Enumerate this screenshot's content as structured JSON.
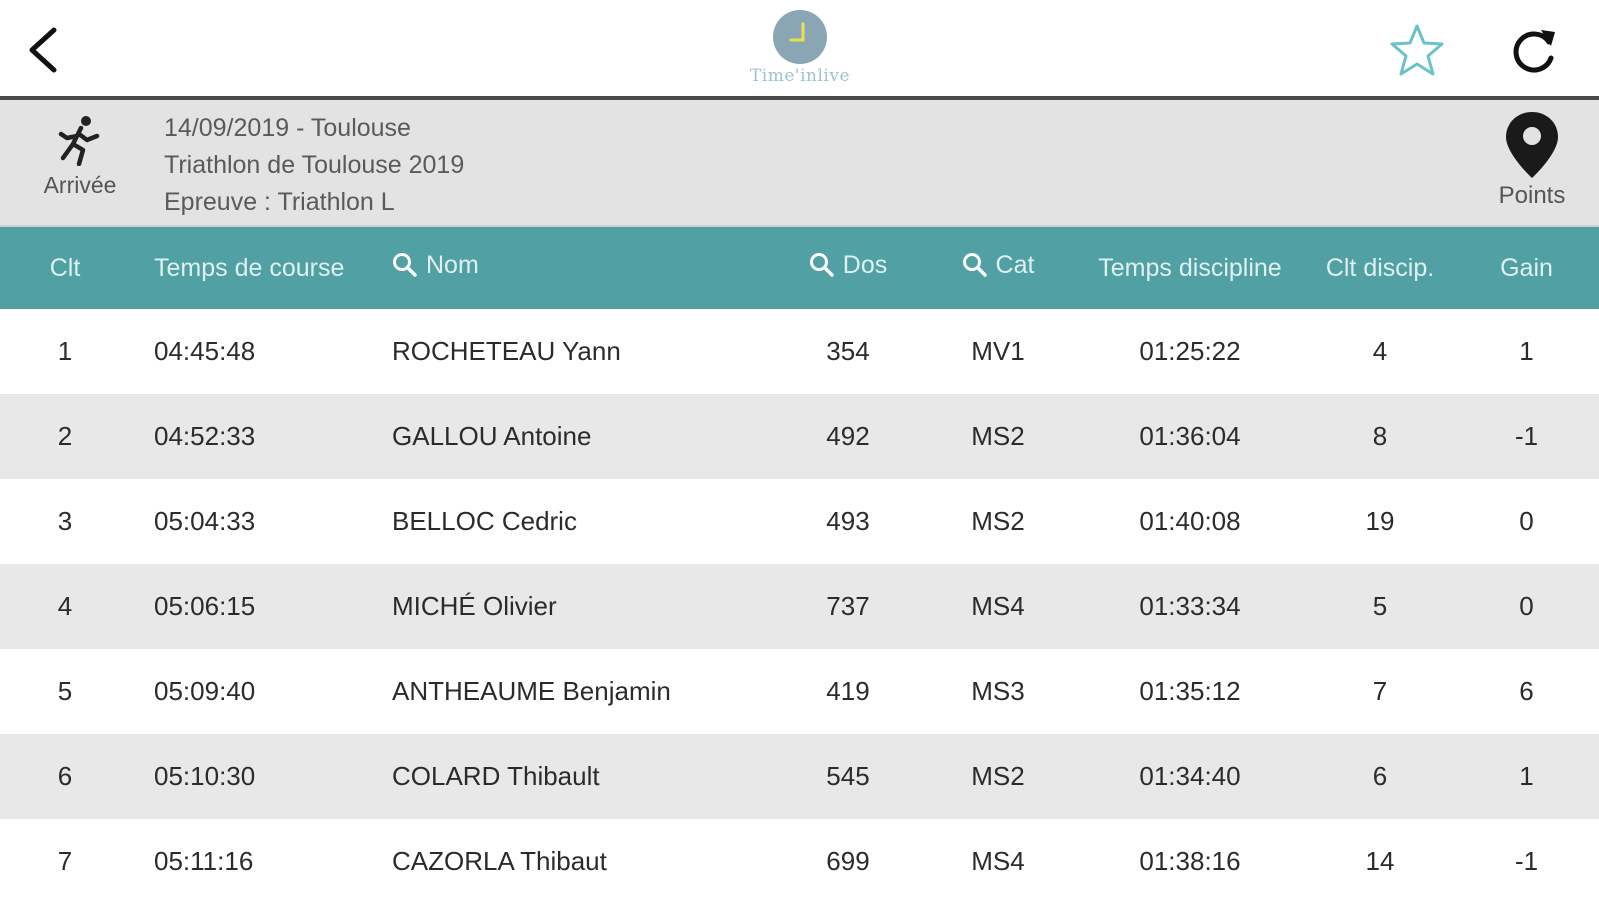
{
  "header": {
    "logo_text": "Time'inlive",
    "icons": {
      "back": "chevron-left-icon",
      "favorite": "star-icon",
      "refresh": "refresh-icon"
    },
    "accent_color": "#6cc2c7"
  },
  "event": {
    "status_label": "Arrivée",
    "date_place": "14/09/2019  - Toulouse",
    "name": "Triathlon de Toulouse 2019",
    "race": "Epreuve : Triathlon L",
    "points_label": "Points",
    "icons": {
      "status": "runner-icon",
      "points": "map-pin-icon"
    },
    "background_color": "#e3e3e3"
  },
  "table": {
    "header_color": "#51a0a3",
    "columns": {
      "clt": "Clt",
      "temps_course": "Temps de course",
      "nom": "Nom",
      "dos": "Dos",
      "cat": "Cat",
      "temps_discipline": "Temps discipline",
      "clt_discip": "Clt discip.",
      "gain": "Gain"
    },
    "rows": [
      {
        "clt": "1",
        "time": "04:45:48",
        "name": "ROCHETEAU Yann",
        "dos": "354",
        "cat": "MV1",
        "tdisc": "01:25:22",
        "cltd": "4",
        "gain": "1"
      },
      {
        "clt": "2",
        "time": "04:52:33",
        "name": "GALLOU Antoine",
        "dos": "492",
        "cat": "MS2",
        "tdisc": "01:36:04",
        "cltd": "8",
        "gain": "-1"
      },
      {
        "clt": "3",
        "time": "05:04:33",
        "name": "BELLOC Cedric",
        "dos": "493",
        "cat": "MS2",
        "tdisc": "01:40:08",
        "cltd": "19",
        "gain": "0"
      },
      {
        "clt": "4",
        "time": "05:06:15",
        "name": "MICHÉ Olivier",
        "dos": "737",
        "cat": "MS4",
        "tdisc": "01:33:34",
        "cltd": "5",
        "gain": "0"
      },
      {
        "clt": "5",
        "time": "05:09:40",
        "name": "ANTHEAUME Benjamin",
        "dos": "419",
        "cat": "MS3",
        "tdisc": "01:35:12",
        "cltd": "7",
        "gain": "6"
      },
      {
        "clt": "6",
        "time": "05:10:30",
        "name": "COLARD Thibault",
        "dos": "545",
        "cat": "MS2",
        "tdisc": "01:34:40",
        "cltd": "6",
        "gain": "1"
      },
      {
        "clt": "7",
        "time": "05:11:16",
        "name": "CAZORLA Thibaut",
        "dos": "699",
        "cat": "MS4",
        "tdisc": "01:38:16",
        "cltd": "14",
        "gain": "-1"
      }
    ]
  }
}
